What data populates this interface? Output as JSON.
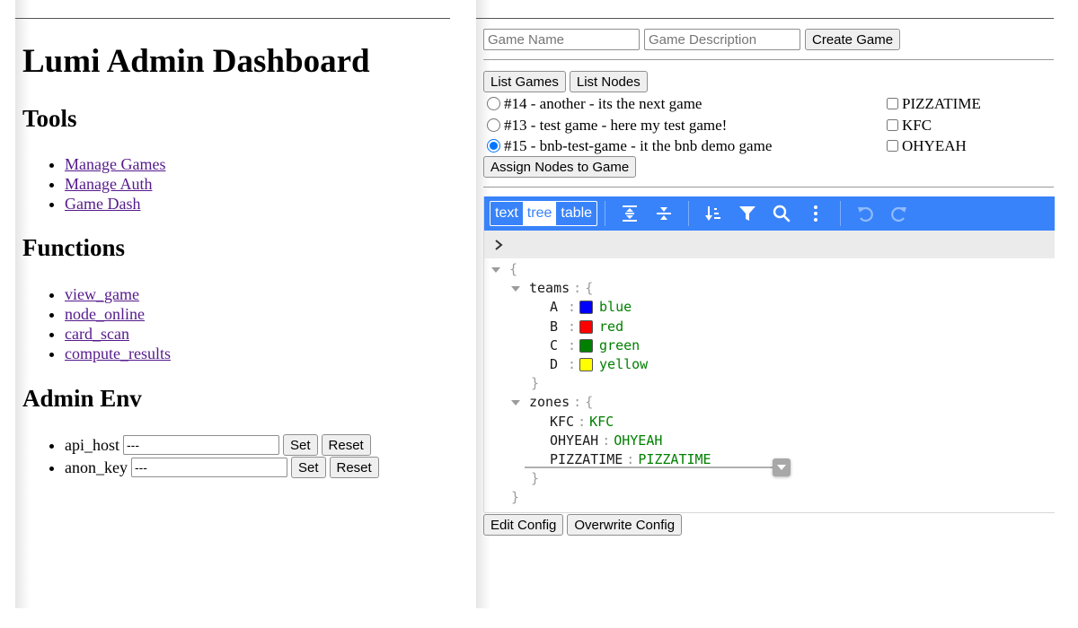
{
  "left": {
    "title": "Lumi Admin Dashboard",
    "tools": {
      "heading": "Tools",
      "links": [
        "Manage Games",
        "Manage Auth",
        "Game Dash"
      ]
    },
    "functions": {
      "heading": "Functions",
      "links": [
        "view_game",
        "node_online",
        "card_scan",
        "compute_results"
      ]
    },
    "admin_env": {
      "heading": "Admin Env",
      "rows": [
        {
          "label": "api_host",
          "value": "---",
          "set_label": "Set",
          "reset_label": "Reset"
        },
        {
          "label": "anon_key",
          "value": "---",
          "set_label": "Set",
          "reset_label": "Reset"
        }
      ]
    }
  },
  "right": {
    "create": {
      "name_placeholder": "Game Name",
      "desc_placeholder": "Game Description",
      "create_label": "Create Game"
    },
    "list_games_label": "List Games",
    "list_nodes_label": "List Nodes",
    "games": [
      {
        "label": "#14 - another - its the next game",
        "selected": false
      },
      {
        "label": "#13 - test game - here my test game!",
        "selected": false
      },
      {
        "label": "#15 - bnb-test-game - it the bnb demo game",
        "selected": true
      }
    ],
    "nodes": [
      {
        "label": "PIZZATIME",
        "checked": false
      },
      {
        "label": "KFC",
        "checked": false
      },
      {
        "label": "OHYEAH",
        "checked": false
      }
    ],
    "assign_label": "Assign Nodes to Game",
    "editor": {
      "modes": [
        "text",
        "tree",
        "table"
      ],
      "active_mode": "tree",
      "tools": [
        "expand-all-icon",
        "collapse-all-icon",
        "sort-icon",
        "filter-icon",
        "search-icon",
        "more-icon",
        "undo-icon",
        "redo-icon"
      ],
      "open_brace": "{",
      "close_brace": "}",
      "colon": ":",
      "teams_key": "teams",
      "teams": [
        {
          "key": "A",
          "value": "blue",
          "color": "#0000ff"
        },
        {
          "key": "B",
          "value": "red",
          "color": "#ff0000"
        },
        {
          "key": "C",
          "value": "green",
          "color": "#008000"
        },
        {
          "key": "D",
          "value": "yellow",
          "color": "#ffff00"
        }
      ],
      "zones_key": "zones",
      "zones": [
        {
          "key": "KFC",
          "value": "KFC"
        },
        {
          "key": "OHYEAH",
          "value": "OHYEAH"
        },
        {
          "key": "PIZZATIME",
          "value": "PIZZATIME"
        }
      ]
    },
    "edit_config_label": "Edit Config",
    "overwrite_config_label": "Overwrite Config"
  }
}
